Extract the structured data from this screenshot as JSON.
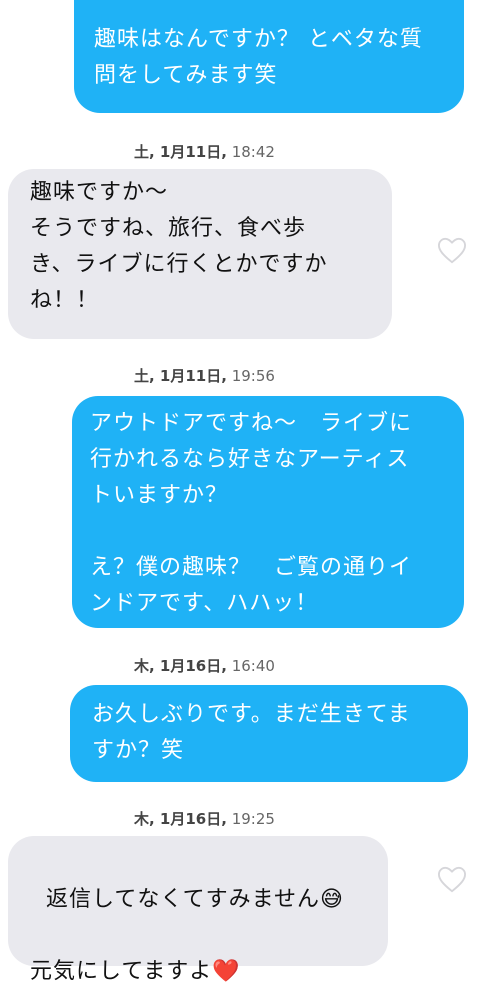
{
  "messages": [
    {
      "type": "out",
      "text": "趣味はなんですか？ とベタな質\n問をしてみます笑"
    },
    {
      "type": "in",
      "text": "趣味ですか〜\nそうですね、旅行、食べ歩\nき、ライブに行くとかですか\nね！！"
    },
    {
      "type": "out",
      "text": "アウトドアですね〜　ライブに\n行かれるなら好きなアーティス\nトいますか？\n\nえ？僕の趣味？　ご覧の通りイ\nンドアです、ハハッ！"
    },
    {
      "type": "out",
      "text": "お久しぶりです。まだ生きてま\nすか？笑"
    },
    {
      "type": "in",
      "text": "返信してなくてすみません",
      "emoji": "😅",
      "text2": "元気にしてますよ",
      "emoji2": "❤️"
    }
  ],
  "timestamps": [
    {
      "day": "土, 1月11日,",
      "time": "18:42"
    },
    {
      "day": "土, 1月11日,",
      "time": "19:56"
    },
    {
      "day": "木, 1月16日,",
      "time": "16:40"
    },
    {
      "day": "木, 1月16日,",
      "time": "19:25"
    }
  ]
}
